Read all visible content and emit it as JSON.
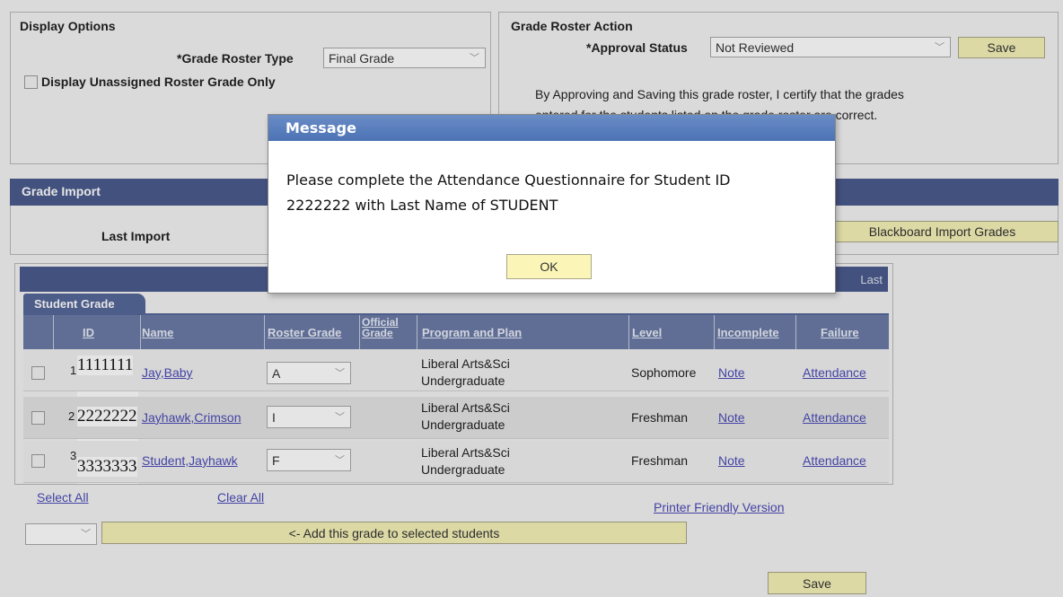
{
  "display_options": {
    "title": "Display Options",
    "roster_type_label": "*Grade Roster Type",
    "roster_type_value": "Final Grade",
    "unassigned_label": "Display Unassigned Roster Grade Only"
  },
  "roster_action": {
    "title": "Grade Roster Action",
    "approval_label": "*Approval Status",
    "approval_value": "Not Reviewed",
    "save_label": "Save",
    "certify_line1": "By Approving and Saving this grade roster, I certify that the grades",
    "certify_line2": "entered for the students listed on the grade roster are correct."
  },
  "grade_import": {
    "title": "Grade Import",
    "last_import_label": "Last Import",
    "blackboard_button": "Blackboard Import Grades"
  },
  "grid": {
    "last_label": "Last",
    "tab_label": "Student Grade",
    "columns": {
      "id": "ID",
      "name": "Name",
      "roster_grade": "Roster Grade",
      "official_grade_1": "Official",
      "official_grade_2": "Grade",
      "program": "Program and Plan",
      "level": "Level",
      "incomplete": "Incomplete",
      "failure": "Failure"
    },
    "rows": [
      {
        "num": "1",
        "id": "1111111",
        "name": "Jay,Baby",
        "grade": "A",
        "program_1": "Liberal Arts&Sci",
        "program_2": "Undergraduate",
        "level": "Sophomore",
        "incomplete": "Note",
        "failure": "Attendance"
      },
      {
        "num": "2",
        "id": "2222222",
        "name": "Jayhawk,Crimson",
        "grade": "I",
        "program_1": "Liberal Arts&Sci",
        "program_2": "Undergraduate",
        "level": "Freshman",
        "incomplete": "Note",
        "failure": "Attendance"
      },
      {
        "num": "3",
        "id": "3333333",
        "name": "Student,Jayhawk",
        "grade": "F",
        "program_1": "Liberal Arts&Sci",
        "program_2": "Undergraduate",
        "level": "Freshman",
        "incomplete": "Note",
        "failure": "Attendance"
      }
    ]
  },
  "bottom": {
    "select_all": "Select All",
    "clear_all": "Clear All",
    "printer_friendly": "Printer Friendly Version",
    "add_grade_button": "<- Add this grade to selected students",
    "save_label": "Save"
  },
  "modal": {
    "title": "Message",
    "line1": "Please complete the Attendance Questionnaire for Student ID",
    "line2": "2222222 with Last Name of STUDENT",
    "ok_label": "OK"
  },
  "icons": {
    "dropdown": "chevron-down-icon"
  }
}
